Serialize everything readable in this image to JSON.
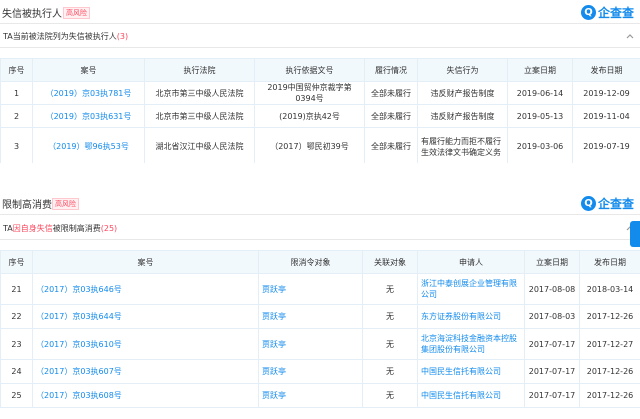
{
  "section1": {
    "title": "失信被执行人",
    "badge": "高风险",
    "logo_mark": "Q",
    "logo_text": "企查查",
    "subtitle_prefix": "TA当前被法院列为失信被执行人",
    "subtitle_count": "(3)",
    "headers": [
      "序号",
      "案号",
      "执行法院",
      "执行依据文号",
      "履行情况",
      "失信行为",
      "立案日期",
      "发布日期"
    ],
    "rows": [
      {
        "no": "1",
        "case": "（2019）京03执781号",
        "court": "北京市第三中级人民法院",
        "basis": "2019中国贸仲京裁字第0394号",
        "status": "全部未履行",
        "behavior": "违反财产报告制度",
        "filed": "2019-06-14",
        "published": "2019-12-09"
      },
      {
        "no": "2",
        "case": "（2019）京03执631号",
        "court": "北京市第三中级人民法院",
        "basis": "(2019)京执42号",
        "status": "全部未履行",
        "behavior": "违反财产报告制度",
        "filed": "2019-05-13",
        "published": "2019-11-04"
      },
      {
        "no": "3",
        "case": "（2019）鄂96执53号",
        "court": "湖北省汉江中级人民法院",
        "basis": "（2017）鄂民初39号",
        "status": "全部未履行",
        "behavior": "有履行能力而拒不履行生效法律文书确定义务",
        "filed": "2019-03-06",
        "published": "2019-07-19"
      }
    ]
  },
  "section2": {
    "title": "限制高消费",
    "badge": "高风险",
    "logo_mark": "Q",
    "logo_text": "企查查",
    "subtitle_prefix": "TA",
    "subtitle_accent": "因自身失信",
    "subtitle_suffix": "被限制高消费",
    "subtitle_count": "(25)",
    "headers": [
      "序号",
      "案号",
      "限消令对象",
      "关联对象",
      "申请人",
      "立案日期",
      "发布日期"
    ],
    "rows": [
      {
        "no": "21",
        "case": "（2017）京03执646号",
        "target": "贾跃亭",
        "related": "无",
        "applicant": "浙江中泰创展企业管理有限公司",
        "filed": "2017-08-08",
        "published": "2018-03-14"
      },
      {
        "no": "22",
        "case": "（2017）京03执644号",
        "target": "贾跃亭",
        "related": "无",
        "applicant": "东方证券股份有限公司",
        "filed": "2017-08-03",
        "published": "2017-12-26"
      },
      {
        "no": "23",
        "case": "（2017）京03执610号",
        "target": "贾跃亭",
        "related": "无",
        "applicant": "北京海淀科技金融资本控股集团股份有限公司",
        "filed": "2017-07-17",
        "published": "2017-12-27"
      },
      {
        "no": "24",
        "case": "（2017）京03执607号",
        "target": "贾跃亭",
        "related": "无",
        "applicant": "中国民生信托有限公司",
        "filed": "2017-07-17",
        "published": "2017-12-26"
      },
      {
        "no": "25",
        "case": "（2017）京03执608号",
        "target": "贾跃亭",
        "related": "无",
        "applicant": "中国民生信托有限公司",
        "filed": "2017-07-17",
        "published": "2017-12-26"
      }
    ]
  },
  "icons": {
    "collapse": "chevron-up-icon",
    "side_tab": "side-tab"
  },
  "colors": {
    "accent": "#128bed",
    "risk": "#fd485e",
    "header_bg": "#f2f9fc"
  }
}
